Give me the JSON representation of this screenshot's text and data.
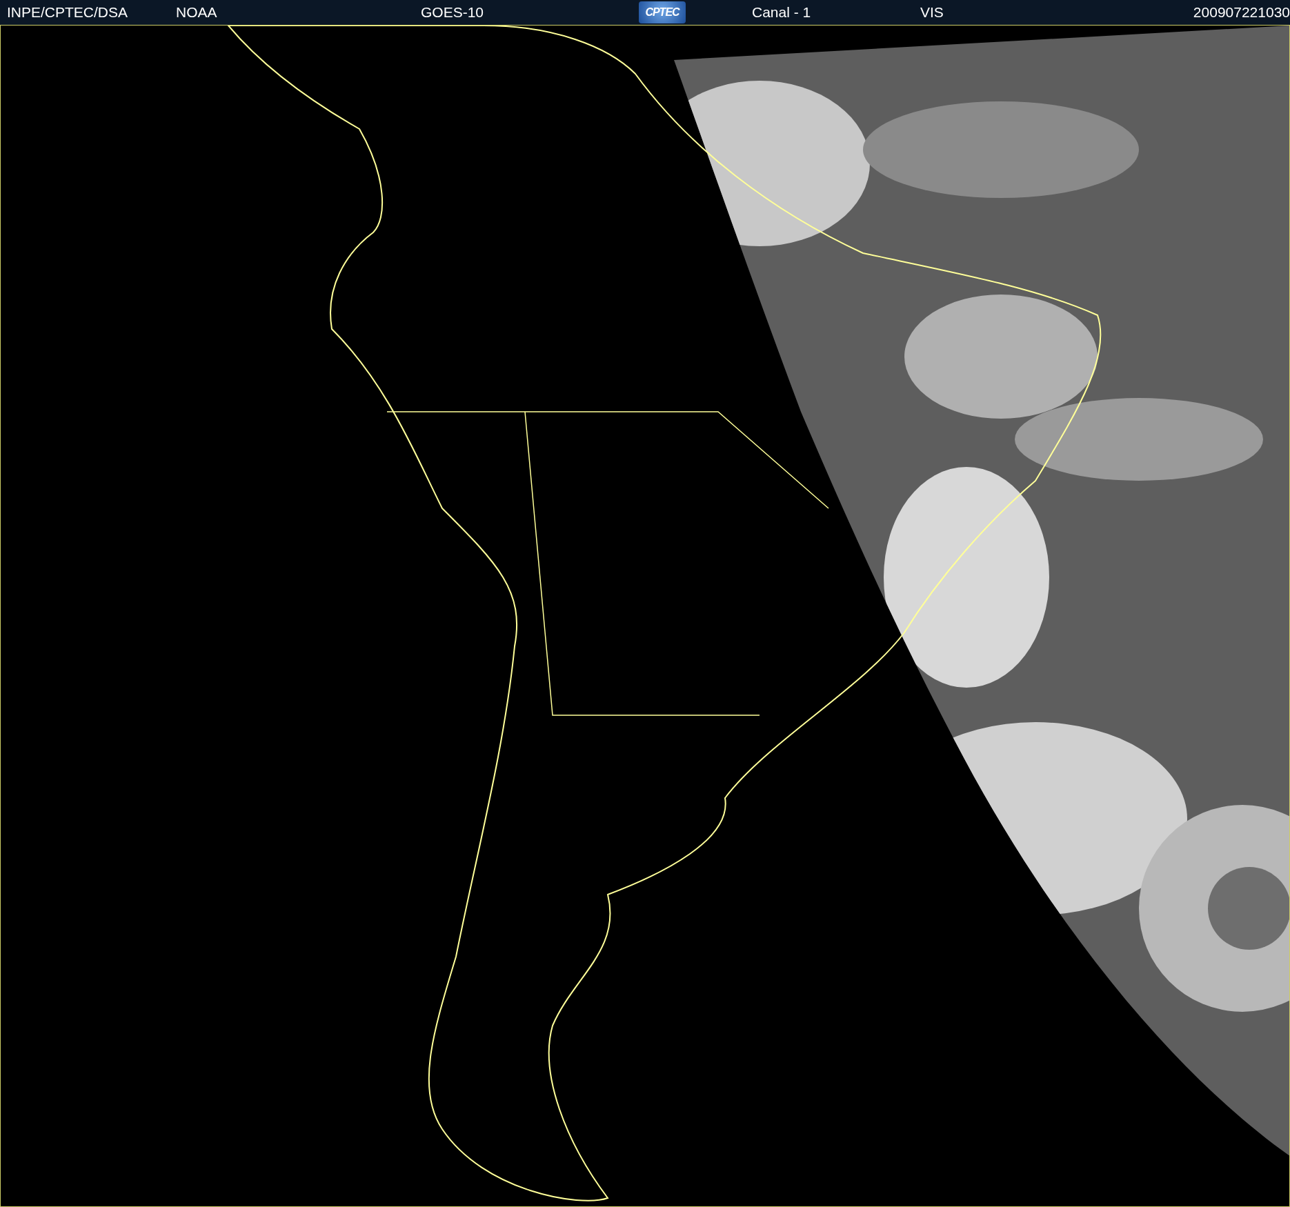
{
  "header": {
    "items": [
      {
        "kind": "text",
        "text": "INPE/CPTEC/DSA"
      },
      {
        "kind": "text",
        "text": "NOAA"
      },
      {
        "kind": "text",
        "text": "GOES-10"
      },
      {
        "kind": "logo",
        "text": "CPTEC"
      },
      {
        "kind": "text",
        "text": "Canal - 1"
      },
      {
        "kind": "text",
        "text": "VIS"
      },
      {
        "kind": "text",
        "text": "200907221030"
      }
    ]
  }
}
